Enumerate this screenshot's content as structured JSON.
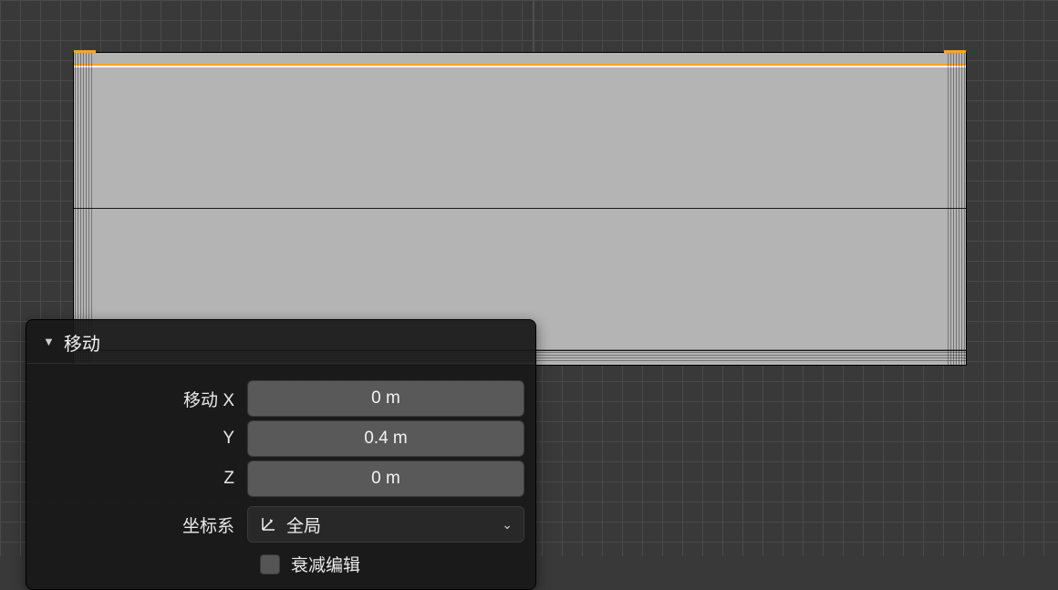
{
  "panel": {
    "title": "移动",
    "move_label": "移动 X",
    "y_label": "Y",
    "z_label": "Z",
    "move_x": "0 m",
    "move_y": "0.4 m",
    "move_z": "0 m",
    "orientation_label": "坐标系",
    "orientation_value": "全局",
    "proportional_label": "衰减编辑",
    "proportional_checked": false
  },
  "colors": {
    "selection": "#f5a623",
    "mesh_fill": "#b4b4b5",
    "panel_bg": "rgba(24,24,24,0.93)"
  }
}
